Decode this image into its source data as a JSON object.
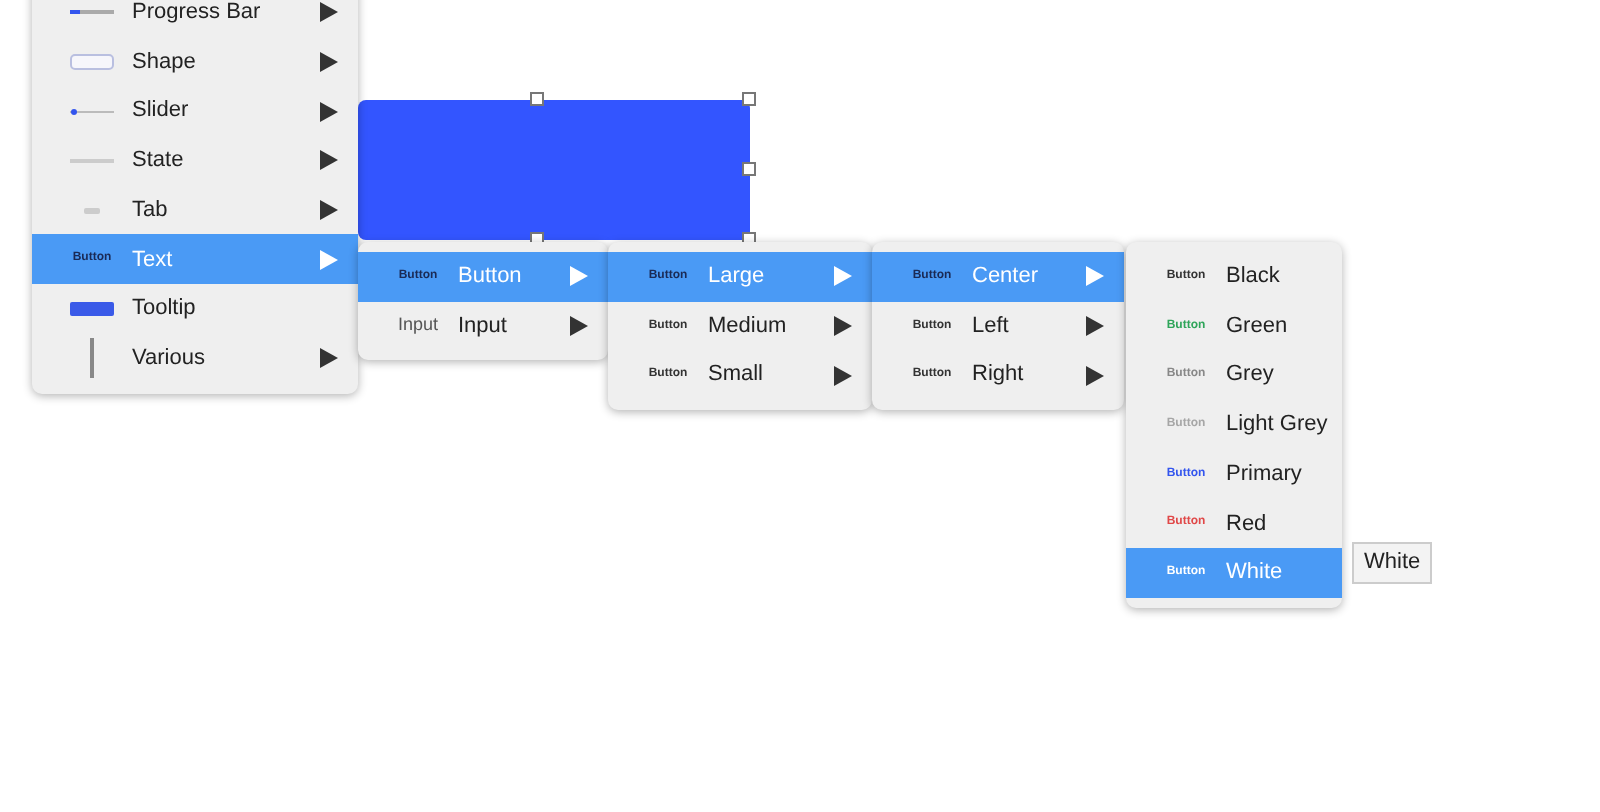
{
  "canvas": {
    "shape": {
      "kind": "rectangle",
      "selected": true
    }
  },
  "menus": [
    {
      "items": [
        {
          "label": "Progress Bar",
          "kind": "progress",
          "submenu": true,
          "selected": false
        },
        {
          "label": "Shape",
          "kind": "shape",
          "submenu": true,
          "selected": false
        },
        {
          "label": "Slider",
          "kind": "slider",
          "submenu": true,
          "selected": false
        },
        {
          "label": "State",
          "kind": "state",
          "submenu": true,
          "selected": false
        },
        {
          "label": "Tab",
          "kind": "tab",
          "submenu": true,
          "selected": false
        },
        {
          "label": "Text",
          "kind": "text",
          "preview_text": "Button",
          "submenu": true,
          "selected": true
        },
        {
          "label": "Tooltip",
          "kind": "tooltip",
          "submenu": false,
          "selected": false
        },
        {
          "label": "Various",
          "kind": "various",
          "submenu": true,
          "selected": false
        }
      ]
    },
    {
      "items": [
        {
          "label": "Button",
          "kind": "text",
          "preview_text": "Button",
          "submenu": true,
          "selected": true
        },
        {
          "label": "Input",
          "kind": "plain",
          "preview_text": "Input",
          "submenu": true,
          "selected": false
        }
      ]
    },
    {
      "items": [
        {
          "label": "Large",
          "kind": "text",
          "preview_text": "Button",
          "submenu": true,
          "selected": true
        },
        {
          "label": "Medium",
          "kind": "text",
          "preview_text": "Button",
          "submenu": true,
          "selected": false
        },
        {
          "label": "Small",
          "kind": "text",
          "preview_text": "Button",
          "submenu": true,
          "selected": false
        }
      ]
    },
    {
      "items": [
        {
          "label": "Center",
          "kind": "text",
          "preview_text": "Button",
          "submenu": true,
          "selected": true
        },
        {
          "label": "Left",
          "kind": "text",
          "preview_text": "Button",
          "submenu": true,
          "selected": false
        },
        {
          "label": "Right",
          "kind": "text",
          "preview_text": "Button",
          "submenu": true,
          "selected": false
        }
      ]
    },
    {
      "items": [
        {
          "label": "Black",
          "kind": "text",
          "preview_text": "Button",
          "color": "#333333",
          "submenu": false,
          "selected": false
        },
        {
          "label": "Green",
          "kind": "text",
          "preview_text": "Button",
          "color": "#2fa55a",
          "submenu": false,
          "selected": false
        },
        {
          "label": "Grey",
          "kind": "text",
          "preview_text": "Button",
          "color": "#888888",
          "submenu": false,
          "selected": false
        },
        {
          "label": "Light Grey",
          "kind": "text",
          "preview_text": "Button",
          "color": "#a6a6a6",
          "submenu": false,
          "selected": false
        },
        {
          "label": "Primary",
          "kind": "text",
          "preview_text": "Button",
          "color": "#3355ee",
          "submenu": false,
          "selected": false
        },
        {
          "label": "Red",
          "kind": "text",
          "preview_text": "Button",
          "color": "#e04848",
          "submenu": false,
          "selected": false
        },
        {
          "label": "White",
          "kind": "text",
          "preview_text": "Button",
          "color": "#ffffff",
          "submenu": false,
          "selected": true
        }
      ]
    }
  ],
  "tooltip": {
    "text": "White"
  }
}
